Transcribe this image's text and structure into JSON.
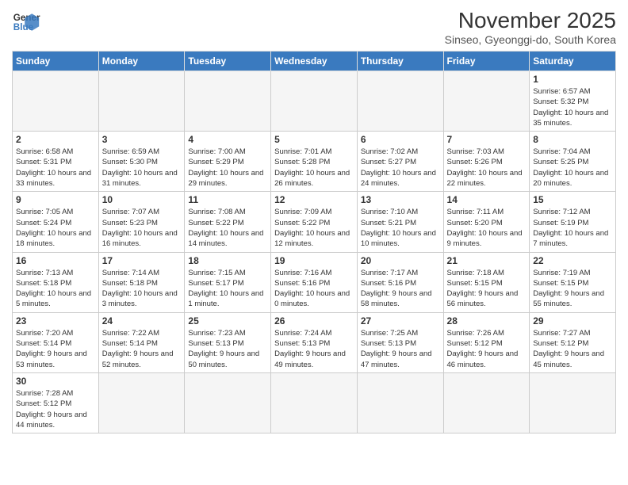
{
  "header": {
    "logo_line1": "General",
    "logo_line2": "Blue",
    "month_title": "November 2025",
    "subtitle": "Sinseo, Gyeonggi-do, South Korea"
  },
  "weekdays": [
    "Sunday",
    "Monday",
    "Tuesday",
    "Wednesday",
    "Thursday",
    "Friday",
    "Saturday"
  ],
  "weeks": [
    [
      {
        "day": "",
        "info": ""
      },
      {
        "day": "",
        "info": ""
      },
      {
        "day": "",
        "info": ""
      },
      {
        "day": "",
        "info": ""
      },
      {
        "day": "",
        "info": ""
      },
      {
        "day": "",
        "info": ""
      },
      {
        "day": "1",
        "info": "Sunrise: 6:57 AM\nSunset: 5:32 PM\nDaylight: 10 hours and 35 minutes."
      }
    ],
    [
      {
        "day": "2",
        "info": "Sunrise: 6:58 AM\nSunset: 5:31 PM\nDaylight: 10 hours and 33 minutes."
      },
      {
        "day": "3",
        "info": "Sunrise: 6:59 AM\nSunset: 5:30 PM\nDaylight: 10 hours and 31 minutes."
      },
      {
        "day": "4",
        "info": "Sunrise: 7:00 AM\nSunset: 5:29 PM\nDaylight: 10 hours and 29 minutes."
      },
      {
        "day": "5",
        "info": "Sunrise: 7:01 AM\nSunset: 5:28 PM\nDaylight: 10 hours and 26 minutes."
      },
      {
        "day": "6",
        "info": "Sunrise: 7:02 AM\nSunset: 5:27 PM\nDaylight: 10 hours and 24 minutes."
      },
      {
        "day": "7",
        "info": "Sunrise: 7:03 AM\nSunset: 5:26 PM\nDaylight: 10 hours and 22 minutes."
      },
      {
        "day": "8",
        "info": "Sunrise: 7:04 AM\nSunset: 5:25 PM\nDaylight: 10 hours and 20 minutes."
      }
    ],
    [
      {
        "day": "9",
        "info": "Sunrise: 7:05 AM\nSunset: 5:24 PM\nDaylight: 10 hours and 18 minutes."
      },
      {
        "day": "10",
        "info": "Sunrise: 7:07 AM\nSunset: 5:23 PM\nDaylight: 10 hours and 16 minutes."
      },
      {
        "day": "11",
        "info": "Sunrise: 7:08 AM\nSunset: 5:22 PM\nDaylight: 10 hours and 14 minutes."
      },
      {
        "day": "12",
        "info": "Sunrise: 7:09 AM\nSunset: 5:22 PM\nDaylight: 10 hours and 12 minutes."
      },
      {
        "day": "13",
        "info": "Sunrise: 7:10 AM\nSunset: 5:21 PM\nDaylight: 10 hours and 10 minutes."
      },
      {
        "day": "14",
        "info": "Sunrise: 7:11 AM\nSunset: 5:20 PM\nDaylight: 10 hours and 9 minutes."
      },
      {
        "day": "15",
        "info": "Sunrise: 7:12 AM\nSunset: 5:19 PM\nDaylight: 10 hours and 7 minutes."
      }
    ],
    [
      {
        "day": "16",
        "info": "Sunrise: 7:13 AM\nSunset: 5:18 PM\nDaylight: 10 hours and 5 minutes."
      },
      {
        "day": "17",
        "info": "Sunrise: 7:14 AM\nSunset: 5:18 PM\nDaylight: 10 hours and 3 minutes."
      },
      {
        "day": "18",
        "info": "Sunrise: 7:15 AM\nSunset: 5:17 PM\nDaylight: 10 hours and 1 minute."
      },
      {
        "day": "19",
        "info": "Sunrise: 7:16 AM\nSunset: 5:16 PM\nDaylight: 10 hours and 0 minutes."
      },
      {
        "day": "20",
        "info": "Sunrise: 7:17 AM\nSunset: 5:16 PM\nDaylight: 9 hours and 58 minutes."
      },
      {
        "day": "21",
        "info": "Sunrise: 7:18 AM\nSunset: 5:15 PM\nDaylight: 9 hours and 56 minutes."
      },
      {
        "day": "22",
        "info": "Sunrise: 7:19 AM\nSunset: 5:15 PM\nDaylight: 9 hours and 55 minutes."
      }
    ],
    [
      {
        "day": "23",
        "info": "Sunrise: 7:20 AM\nSunset: 5:14 PM\nDaylight: 9 hours and 53 minutes."
      },
      {
        "day": "24",
        "info": "Sunrise: 7:22 AM\nSunset: 5:14 PM\nDaylight: 9 hours and 52 minutes."
      },
      {
        "day": "25",
        "info": "Sunrise: 7:23 AM\nSunset: 5:13 PM\nDaylight: 9 hours and 50 minutes."
      },
      {
        "day": "26",
        "info": "Sunrise: 7:24 AM\nSunset: 5:13 PM\nDaylight: 9 hours and 49 minutes."
      },
      {
        "day": "27",
        "info": "Sunrise: 7:25 AM\nSunset: 5:13 PM\nDaylight: 9 hours and 47 minutes."
      },
      {
        "day": "28",
        "info": "Sunrise: 7:26 AM\nSunset: 5:12 PM\nDaylight: 9 hours and 46 minutes."
      },
      {
        "day": "29",
        "info": "Sunrise: 7:27 AM\nSunset: 5:12 PM\nDaylight: 9 hours and 45 minutes."
      }
    ],
    [
      {
        "day": "30",
        "info": "Sunrise: 7:28 AM\nSunset: 5:12 PM\nDaylight: 9 hours and 44 minutes."
      },
      {
        "day": "",
        "info": ""
      },
      {
        "day": "",
        "info": ""
      },
      {
        "day": "",
        "info": ""
      },
      {
        "day": "",
        "info": ""
      },
      {
        "day": "",
        "info": ""
      },
      {
        "day": "",
        "info": ""
      }
    ]
  ]
}
